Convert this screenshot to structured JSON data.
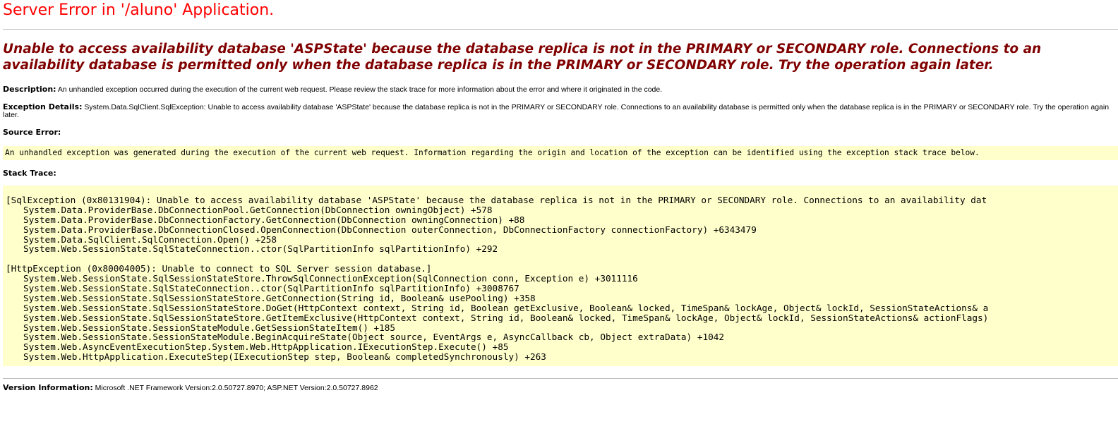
{
  "page": {
    "title": "Server Error in '/aluno' Application.",
    "message": "Unable to access availability database 'ASPState' because the database replica is not in the PRIMARY or SECONDARY role. Connections to an availability database is permitted only when the database replica is in the PRIMARY or SECONDARY role. Try the operation again later.",
    "description": {
      "label": "Description:",
      "text": "An unhandled exception occurred during the execution of the current web request. Please review the stack trace for more information about the error and where it originated in the code."
    },
    "exception_details": {
      "label": "Exception Details:",
      "text": "System.Data.SqlClient.SqlException: Unable to access availability database 'ASPState' because the database replica is not in the PRIMARY or SECONDARY role. Connections to an availability database is permitted only when the database replica is in the PRIMARY or SECONDARY role. Try the operation again later."
    },
    "source_error": {
      "label": "Source Error:",
      "text": "An unhandled exception was generated during the execution of the current web request. Information regarding the origin and location of the exception can be identified using the exception stack trace below."
    },
    "stack_trace": {
      "label": "Stack Trace:",
      "lines": [
        {
          "kind": "header",
          "text": "[SqlException (0x80131904): Unable to access availability database 'ASPState' because the database replica is not in the PRIMARY or SECONDARY role. Connections to an availability dat"
        },
        {
          "kind": "frame",
          "text": "System.Data.ProviderBase.DbConnectionPool.GetConnection(DbConnection owningObject) +578"
        },
        {
          "kind": "frame",
          "text": "System.Data.ProviderBase.DbConnectionFactory.GetConnection(DbConnection owningConnection) +88"
        },
        {
          "kind": "frame",
          "text": "System.Data.ProviderBase.DbConnectionClosed.OpenConnection(DbConnection outerConnection, DbConnectionFactory connectionFactory) +6343479"
        },
        {
          "kind": "frame",
          "text": "System.Data.SqlClient.SqlConnection.Open() +258"
        },
        {
          "kind": "frame",
          "text": "System.Web.SessionState.SqlStateConnection..ctor(SqlPartitionInfo sqlPartitionInfo) +292"
        },
        {
          "kind": "blank",
          "text": ""
        },
        {
          "kind": "header",
          "text": "[HttpException (0x80004005): Unable to connect to SQL Server session database.]"
        },
        {
          "kind": "frame",
          "text": "System.Web.SessionState.SqlSessionStateStore.ThrowSqlConnectionException(SqlConnection conn, Exception e) +3011116"
        },
        {
          "kind": "frame",
          "text": "System.Web.SessionState.SqlStateConnection..ctor(SqlPartitionInfo sqlPartitionInfo) +3008767"
        },
        {
          "kind": "frame",
          "text": "System.Web.SessionState.SqlSessionStateStore.GetConnection(String id, Boolean& usePooling) +358"
        },
        {
          "kind": "frame",
          "text": "System.Web.SessionState.SqlSessionStateStore.DoGet(HttpContext context, String id, Boolean getExclusive, Boolean& locked, TimeSpan& lockAge, Object& lockId, SessionStateActions& a"
        },
        {
          "kind": "frame",
          "text": "System.Web.SessionState.SqlSessionStateStore.GetItemExclusive(HttpContext context, String id, Boolean& locked, TimeSpan& lockAge, Object& lockId, SessionStateActions& actionFlags)"
        },
        {
          "kind": "frame",
          "text": "System.Web.SessionState.SessionStateModule.GetSessionStateItem() +185"
        },
        {
          "kind": "frame",
          "text": "System.Web.SessionState.SessionStateModule.BeginAcquireState(Object source, EventArgs e, AsyncCallback cb, Object extraData) +1042"
        },
        {
          "kind": "frame",
          "text": "System.Web.AsyncEventExecutionStep.System.Web.HttpApplication.IExecutionStep.Execute() +85"
        },
        {
          "kind": "frame",
          "text": "System.Web.HttpApplication.ExecuteStep(IExecutionStep step, Boolean& completedSynchronously) +263"
        }
      ]
    },
    "version_info": {
      "label": "Version Information:",
      "text": "Microsoft .NET Framework Version:2.0.50727.8970; ASP.NET Version:2.0.50727.8962"
    }
  },
  "colors": {
    "title": "#ff0000",
    "message": "#800000",
    "code_background": "#ffffcc",
    "rule": "#c0c0c0"
  }
}
